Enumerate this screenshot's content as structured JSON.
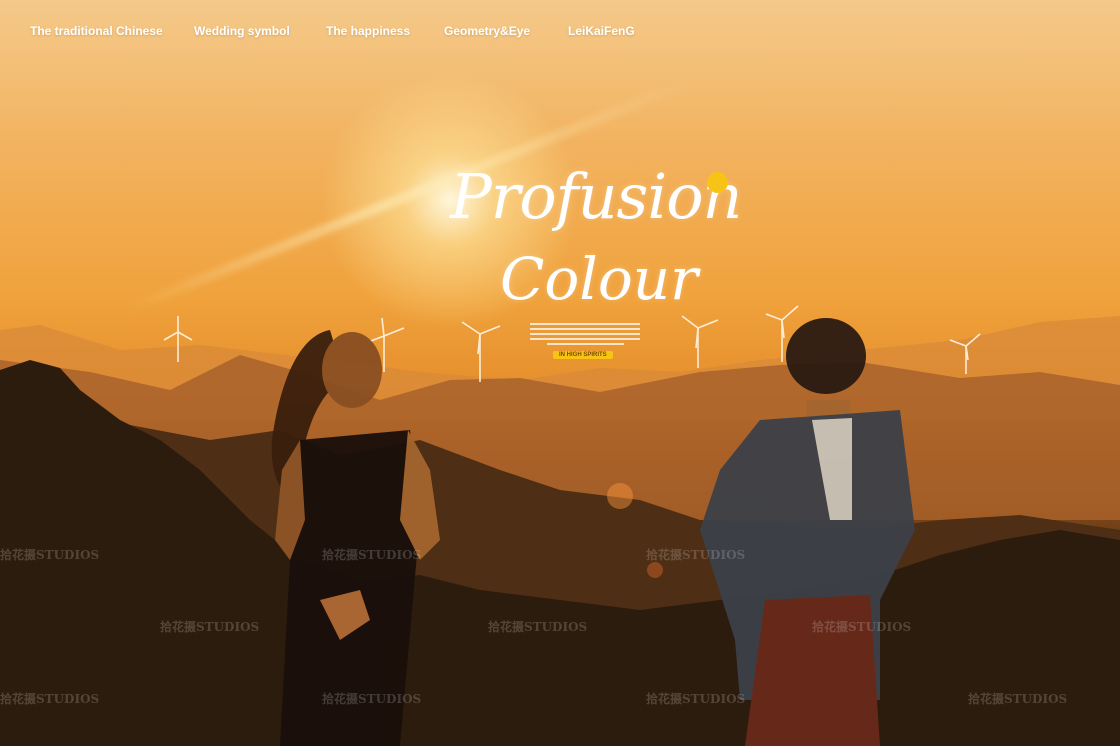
{
  "nav": {
    "items": [
      {
        "label": "The traditional Chinese"
      },
      {
        "label": "Wedding symbol"
      },
      {
        "label": "The happiness"
      },
      {
        "label": "Geometry&Eye"
      },
      {
        "label": "LeiKaiFenG"
      }
    ]
  },
  "hero": {
    "title_line1": "Profusion",
    "title_line2": "Colour",
    "badge": "IN HIGH SPIRITS",
    "accent_color": "#f7c416"
  },
  "watermark": {
    "text": "拾花摄STUDIOS"
  }
}
